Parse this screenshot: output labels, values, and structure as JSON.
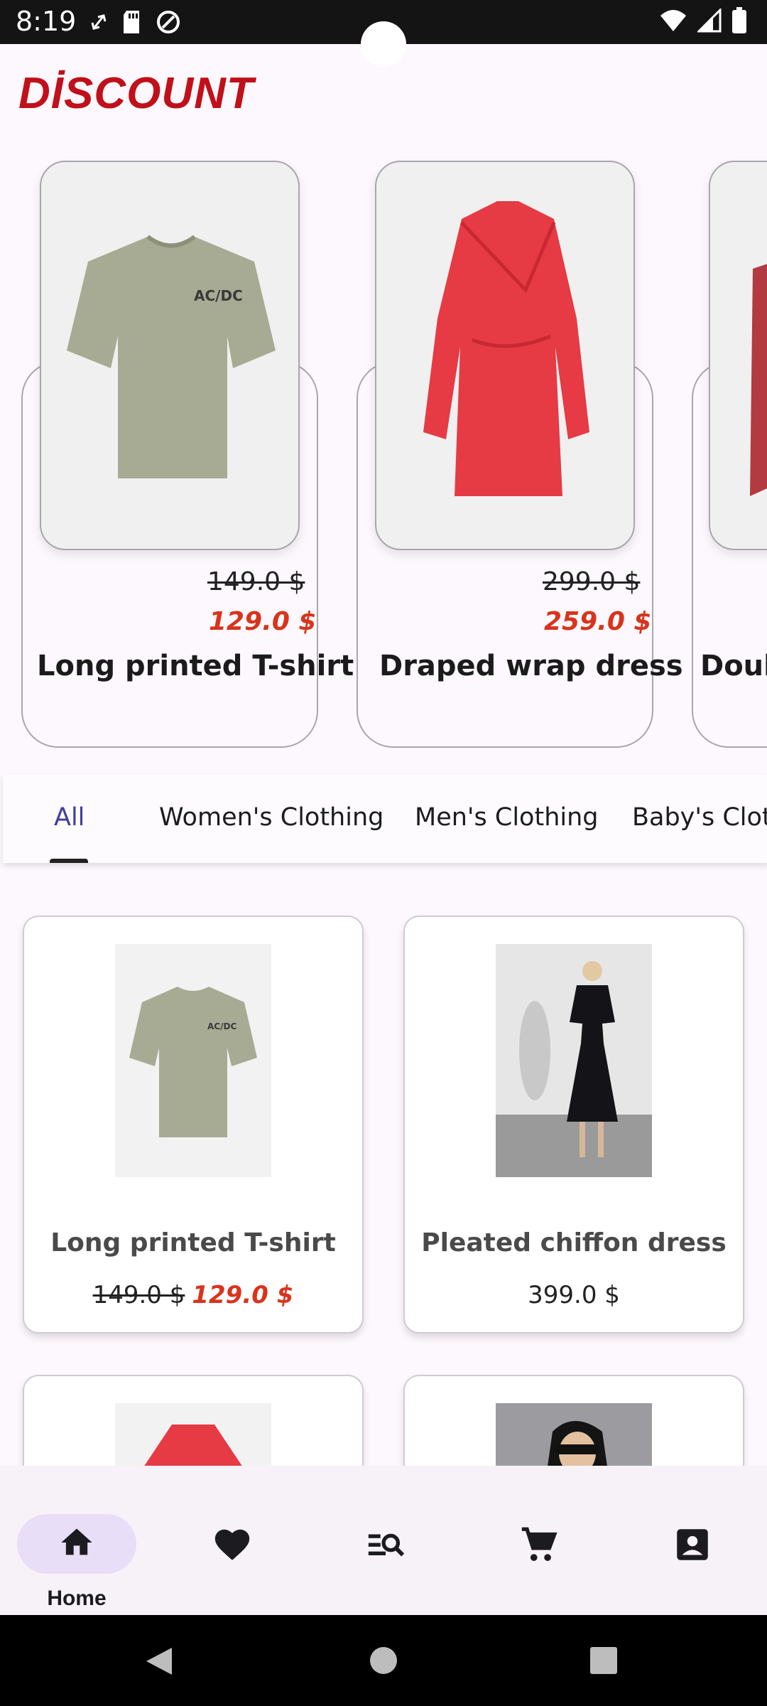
{
  "status_bar": {
    "time": "8:19"
  },
  "page_title": "DİSCOUNT",
  "discount_items": [
    {
      "name": "Long printed T-shirt",
      "old_price": "149.0 $",
      "new_price": "129.0 $"
    },
    {
      "name": "Draped wrap dress",
      "old_price": "299.0 $",
      "new_price": "259.0 $"
    },
    {
      "name": "Doub"
    }
  ],
  "tabs": [
    "All",
    "Women's Clothing",
    "Men's Clothing",
    "Baby's Cloth"
  ],
  "products": [
    {
      "name": "Long printed T-shirt",
      "old_price": "149.0 $",
      "new_price": "129.0 $"
    },
    {
      "name": "Pleated chiffon dress",
      "price": "399.0 $"
    }
  ],
  "bottom_nav": {
    "home_label": "Home",
    "items": [
      "home-icon",
      "favorite-icon",
      "search-list-icon",
      "cart-icon",
      "account-icon"
    ]
  },
  "colors": {
    "accent": "#c0101a",
    "sale": "#d8341d",
    "tab_active": "#3f3f9f",
    "nav_pill": "#e8def8"
  }
}
